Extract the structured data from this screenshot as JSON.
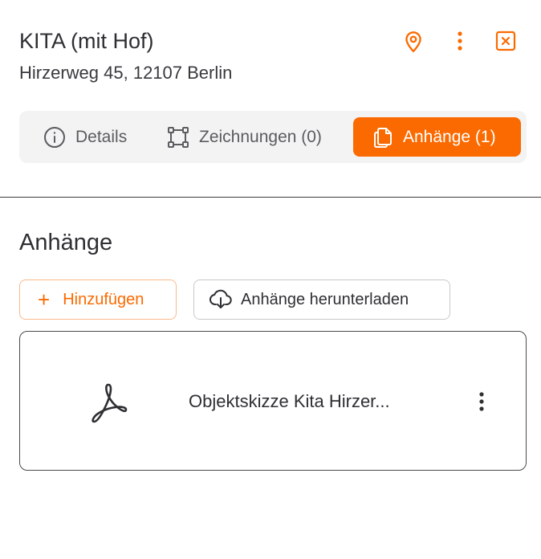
{
  "header": {
    "title": "KITA (mit Hof)",
    "address": "Hirzerweg 45, 12107 Berlin",
    "icons": {
      "location": "map-pin-icon",
      "more": "more-vertical-icon",
      "close": "close-box-icon"
    }
  },
  "tabs": [
    {
      "label": "Details",
      "icon": "info-circle-icon",
      "active": false
    },
    {
      "label": "Zeichnungen (0)",
      "icon": "vector-square-icon",
      "active": false
    },
    {
      "label": "Anhänge (1)",
      "icon": "files-icon",
      "active": true
    }
  ],
  "section": {
    "title": "Anhänge",
    "add_button": "Hinzufügen",
    "download_button": "Anhänge herunterladen"
  },
  "attachments": [
    {
      "name": "Objektskizze Kita Hirzer...",
      "icon": "pdf-icon"
    }
  ],
  "colors": {
    "accent": "#fb6a00",
    "text": "#2f2f33",
    "tabbar": "#f3f3f4"
  }
}
